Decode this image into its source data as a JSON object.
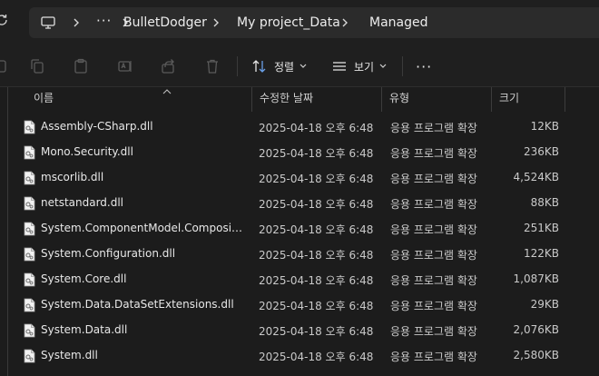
{
  "address": {
    "ellipsis": "···",
    "crumbs": [
      "BulletDodger",
      "My project_Data",
      "Managed"
    ]
  },
  "toolbar": {
    "sort_label": "정렬",
    "view_label": "보기",
    "more_label": "···"
  },
  "columns": {
    "name": "이름",
    "date": "수정한 날짜",
    "type": "유형",
    "size": "크기"
  },
  "files": [
    {
      "name": "Assembly-CSharp.dll",
      "date": "2025-04-18 오후 6:48",
      "type": "응용 프로그램 확장",
      "size": "12KB"
    },
    {
      "name": "Mono.Security.dll",
      "date": "2025-04-18 오후 6:48",
      "type": "응용 프로그램 확장",
      "size": "236KB"
    },
    {
      "name": "mscorlib.dll",
      "date": "2025-04-18 오후 6:48",
      "type": "응용 프로그램 확장",
      "size": "4,524KB"
    },
    {
      "name": "netstandard.dll",
      "date": "2025-04-18 오후 6:48",
      "type": "응용 프로그램 확장",
      "size": "88KB"
    },
    {
      "name": "System.ComponentModel.Composition....",
      "date": "2025-04-18 오후 6:48",
      "type": "응용 프로그램 확장",
      "size": "251KB"
    },
    {
      "name": "System.Configuration.dll",
      "date": "2025-04-18 오후 6:48",
      "type": "응용 프로그램 확장",
      "size": "122KB"
    },
    {
      "name": "System.Core.dll",
      "date": "2025-04-18 오후 6:48",
      "type": "응용 프로그램 확장",
      "size": "1,087KB"
    },
    {
      "name": "System.Data.DataSetExtensions.dll",
      "date": "2025-04-18 오후 6:48",
      "type": "응용 프로그램 확장",
      "size": "29KB"
    },
    {
      "name": "System.Data.dll",
      "date": "2025-04-18 오후 6:48",
      "type": "응용 프로그램 확장",
      "size": "2,076KB"
    },
    {
      "name": "System.dll",
      "date": "2025-04-18 오후 6:48",
      "type": "응용 프로그램 확장",
      "size": "2,580KB"
    }
  ],
  "colors": {
    "background": "#1c1c1c",
    "address_box": "#2b2b2b",
    "text": "#e6e6e6"
  }
}
